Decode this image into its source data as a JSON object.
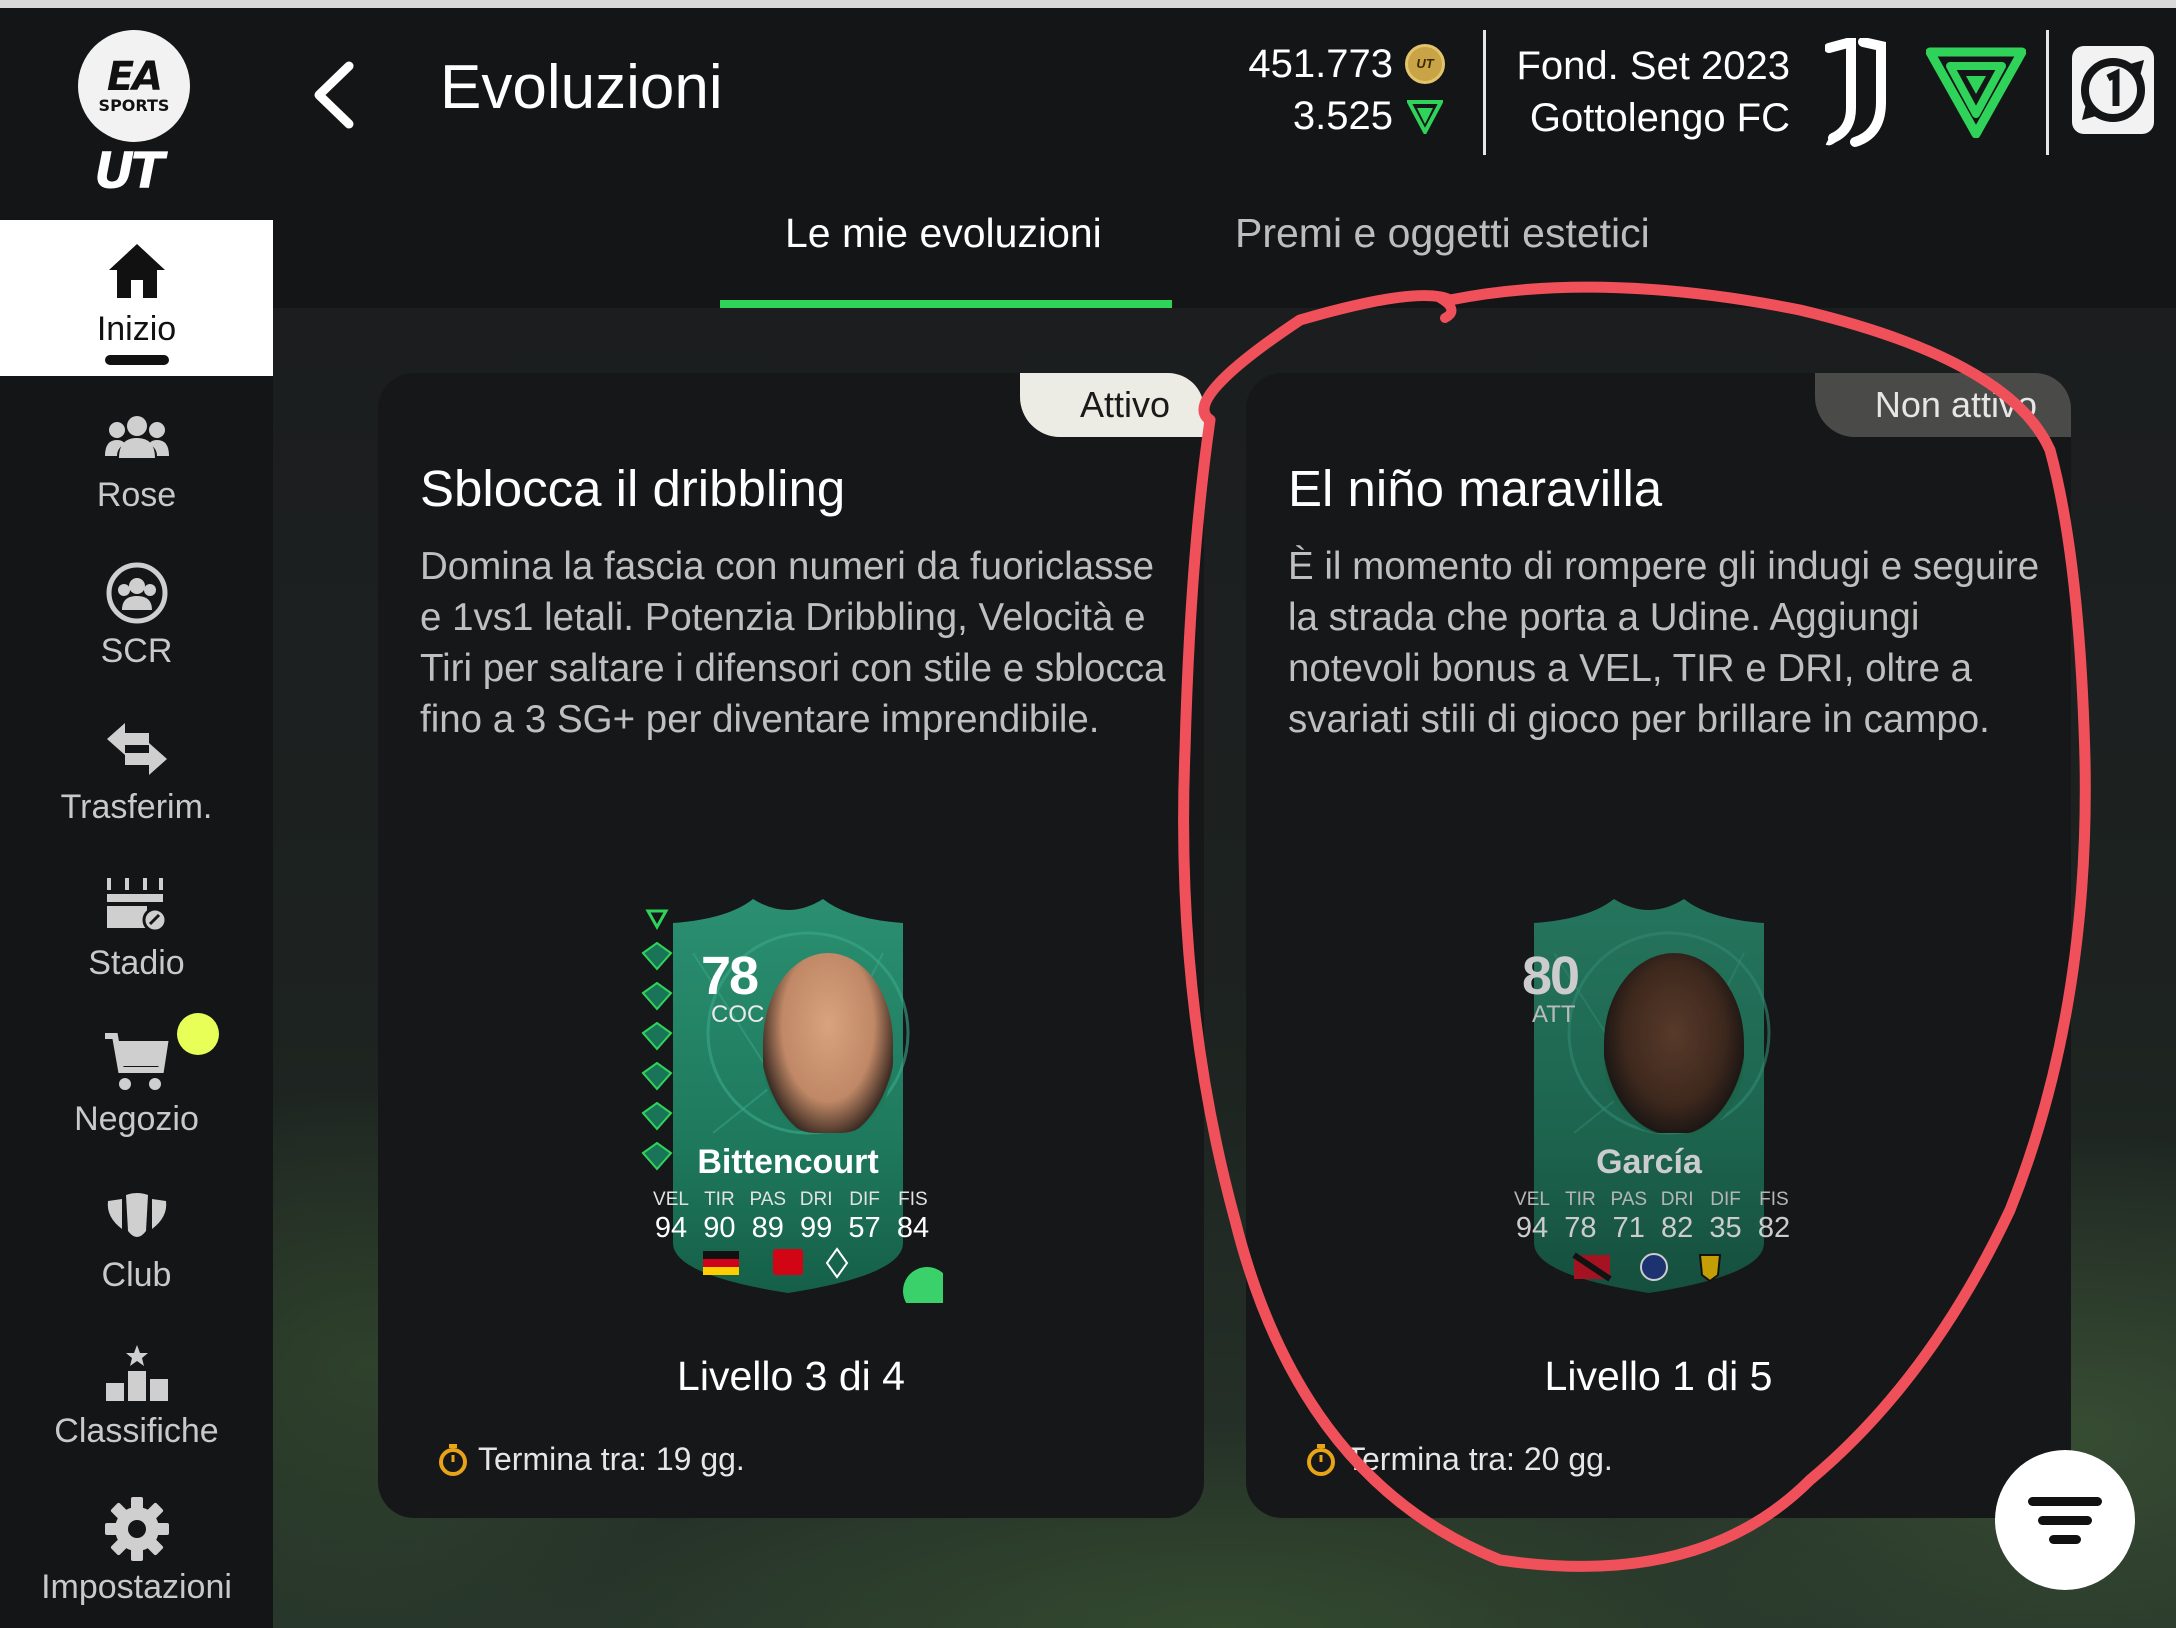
{
  "colors": {
    "accent": "#2fd35a",
    "active_badge": "#ecebe4",
    "inactive_badge": "#4a4a48",
    "annotation": "#f0505a",
    "notification": "#e8ff57"
  },
  "logo": {
    "ea": "EA",
    "sports": "SPORTS",
    "ut": "UT"
  },
  "sidebar": {
    "items": [
      {
        "label": "Inizio",
        "icon": "home-icon",
        "active": true
      },
      {
        "label": "Rose",
        "icon": "squad-icon"
      },
      {
        "label": "SCR",
        "icon": "squad-battles-icon"
      },
      {
        "label": "Trasferim.",
        "icon": "transfer-icon"
      },
      {
        "label": "Stadio",
        "icon": "stadium-icon"
      },
      {
        "label": "Negozio",
        "icon": "store-icon",
        "notification": true
      },
      {
        "label": "Club",
        "icon": "club-icon"
      },
      {
        "label": "Classifiche",
        "icon": "leaderboard-icon"
      },
      {
        "label": "Impostazioni",
        "icon": "settings-icon"
      }
    ]
  },
  "header": {
    "title": "Evoluzioni",
    "coins": "451.773",
    "points": "3.525",
    "founded": "Fond. Set 2023",
    "club_name": "Gottolengo FC"
  },
  "tabs": [
    {
      "label": "Le mie evoluzioni",
      "active": true
    },
    {
      "label": "Premi e oggetti estetici",
      "active": false
    }
  ],
  "evolutions": [
    {
      "status": "Attivo",
      "title": "Sblocca il dribbling",
      "description": "Domina la fascia con numeri da fuoriclasse e 1vs1 letali. Potenzia Dribbling, Velocità e Tiri per saltare i difensori con stile e sblocca fino a 3 SG+ per diventare imprendibile.",
      "player": {
        "rating": "78",
        "position": "COC",
        "name": "Bittencourt",
        "stats": [
          {
            "label": "VEL",
            "value": "94"
          },
          {
            "label": "TIR",
            "value": "90"
          },
          {
            "label": "PAS",
            "value": "89"
          },
          {
            "label": "DRI",
            "value": "99"
          },
          {
            "label": "DIF",
            "value": "57"
          },
          {
            "label": "FIS",
            "value": "84"
          }
        ]
      },
      "level": "Livello 3 di 4",
      "ends": "Termina tra: 19 gg."
    },
    {
      "status": "Non attivo",
      "title": "El niño maravilla",
      "description": "È il momento di rompere gli indugi e seguire la strada che porta a Udine. Aggiungi notevoli bonus a VEL, TIR e DRI, oltre a svariati stili di gioco per brillare in campo.",
      "player": {
        "rating": "80",
        "position": "ATT",
        "name": "García",
        "stats": [
          {
            "label": "VEL",
            "value": "94"
          },
          {
            "label": "TIR",
            "value": "78"
          },
          {
            "label": "PAS",
            "value": "71"
          },
          {
            "label": "DRI",
            "value": "82"
          },
          {
            "label": "DIF",
            "value": "35"
          },
          {
            "label": "FIS",
            "value": "82"
          }
        ]
      },
      "level": "Livello 1 di 5",
      "ends": "Termina tra: 20 gg."
    }
  ]
}
